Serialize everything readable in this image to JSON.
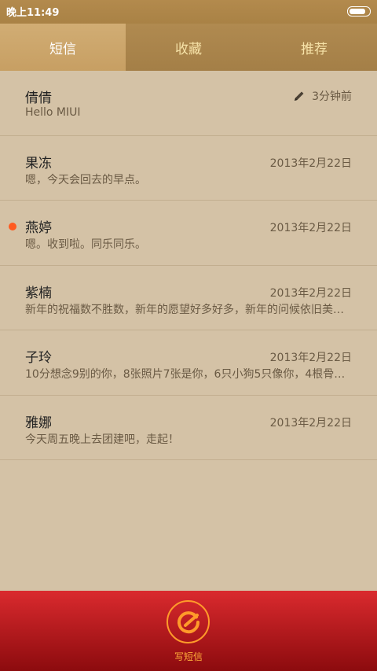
{
  "status_bar": {
    "time": "晚上11:49",
    "battery_level": 0.85
  },
  "tabs": [
    {
      "label": "短信",
      "active": true
    },
    {
      "label": "收藏",
      "active": false
    },
    {
      "label": "推荐",
      "active": false
    }
  ],
  "messages": [
    {
      "name": "倩倩",
      "preview": "Hello MIUI",
      "date": "3分钟前",
      "draft": true,
      "unread": false
    },
    {
      "name": "果冻",
      "preview": "嗯，今天会回去的早点。",
      "date": "2013年2月22日",
      "draft": false,
      "unread": false
    },
    {
      "name": "燕婷",
      "preview": "嗯。收到啦。同乐同乐。",
      "date": "2013年2月22日",
      "draft": false,
      "unread": true
    },
    {
      "name": "紫楠",
      "preview": "新年的祝福数不胜数，新年的愿望好多好多，新年的问候依旧美好…",
      "date": "2013年2月22日",
      "draft": false,
      "unread": false
    },
    {
      "name": "子玲",
      "preview": "10分想念9别的你，8张照片7张是你，6只小狗5只像你，4根骨头…",
      "date": "2013年2月22日",
      "draft": false,
      "unread": false
    },
    {
      "name": "雅娜",
      "preview": "今天周五晚上去团建吧，走起！",
      "date": "2013年2月22日",
      "draft": false,
      "unread": false
    }
  ],
  "compose": {
    "label": "写短信",
    "icon": "compose-icon"
  },
  "colors": {
    "accent": "#ff9b2a",
    "unread_dot": "#ff5a1f",
    "bottom_bar": "#c81f24"
  }
}
